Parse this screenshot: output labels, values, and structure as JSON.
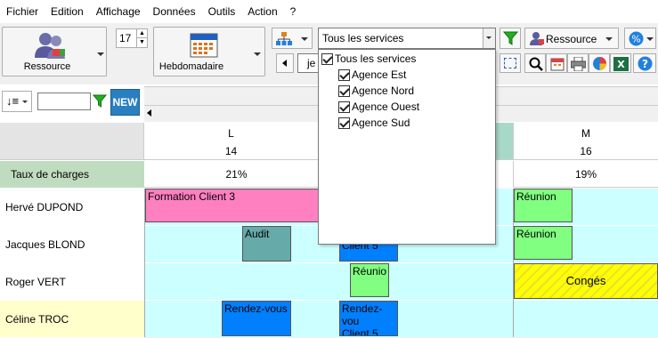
{
  "menu": [
    "Fichier",
    "Edition",
    "Affichage",
    "Données",
    "Outils",
    "Action",
    "?"
  ],
  "toolbar": {
    "resource_label": "Ressource",
    "spin_value": "17",
    "view_label": "Hebdomadaire",
    "services_combo": "Tous les services",
    "resource_combo": "Ressource",
    "nav_text": "je",
    "new_label": "NEW"
  },
  "dropdown": {
    "items": [
      "Tous les services",
      "Agence Est",
      "Agence Nord",
      "Agence Ouest",
      "Agence Sud"
    ]
  },
  "grid": {
    "days": [
      {
        "letter": "L",
        "num": "14"
      },
      {
        "letter": "M",
        "num": "16"
      }
    ],
    "charge_label": "Taux de charges",
    "charges": [
      "21%",
      "19%"
    ],
    "rows": [
      "Hervé DUPOND",
      "Jacques BLOND",
      "Roger VERT",
      "Céline TROC"
    ],
    "events": {
      "e1": "Formation Client 3",
      "e2": "Réunion",
      "e3": "Audit",
      "e4": "Client 5",
      "e5": "Réunion",
      "e6": "Réunio",
      "e7": "Congés",
      "e8": "Rendez-vous",
      "e9a": "Rendez-vou",
      "e9b": "Client 5"
    }
  },
  "colors": {
    "pink": "#ff80c0",
    "green": "#80ff80",
    "teal": "#66aaaa",
    "blue": "#0080ff",
    "yellow": "#ffff00",
    "band": "#ccffff",
    "charge_bg": "#c0dcc0",
    "header_sel": "#a8d8c8"
  }
}
